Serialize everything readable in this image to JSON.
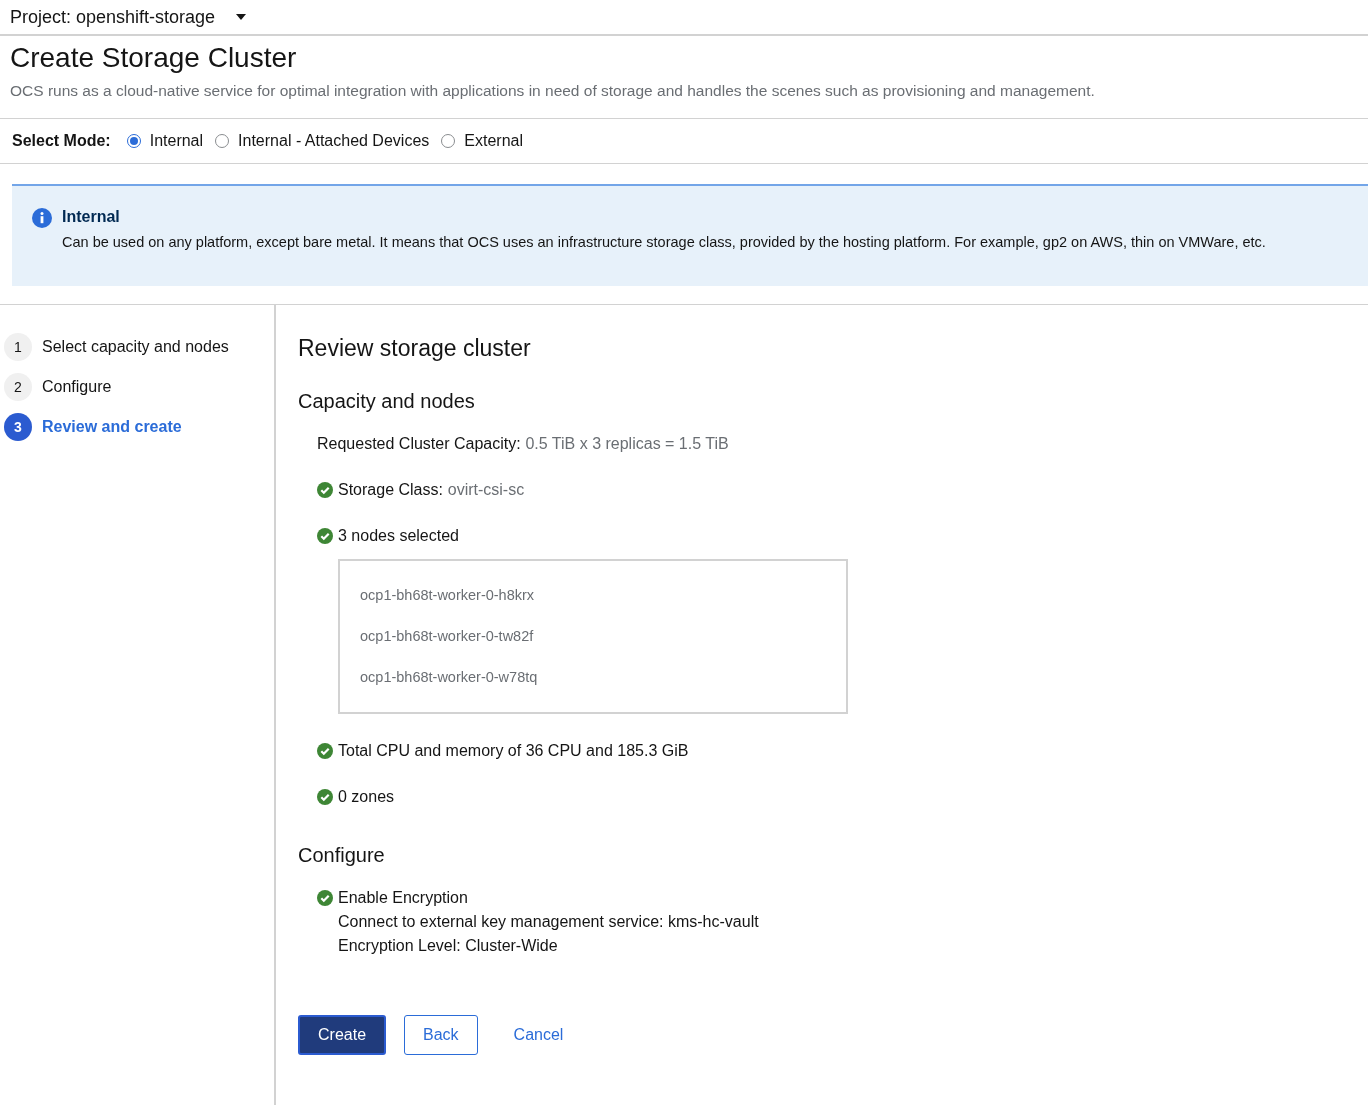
{
  "project": {
    "label": "Project: openshift-storage"
  },
  "page": {
    "title": "Create Storage Cluster",
    "description": "OCS runs as a cloud-native service for optimal integration with applications in need of storage and handles the scenes such as provisioning and management."
  },
  "mode": {
    "label": "Select Mode:",
    "options": [
      {
        "label": "Internal",
        "selected": true
      },
      {
        "label": "Internal - Attached Devices",
        "selected": false
      },
      {
        "label": "External",
        "selected": false
      }
    ]
  },
  "alert": {
    "title": "Internal",
    "text": "Can be used on any platform, except bare metal. It means that OCS uses an infrastructure storage class, provided by the hosting platform. For example, gp2 on AWS, thin on VMWare, etc."
  },
  "steps": [
    {
      "number": "1",
      "label": "Select capacity and nodes",
      "selected": false
    },
    {
      "number": "2",
      "label": "Configure",
      "selected": false
    },
    {
      "number": "3",
      "label": "Review and create",
      "selected": true
    }
  ],
  "review": {
    "title": "Review storage cluster",
    "sections": [
      {
        "title": "Capacity and nodes",
        "items": [
          {
            "checked": false,
            "label": "Requested Cluster Capacity:",
            "value": "0.5 TiB x 3 replicas = 1.5 TiB"
          },
          {
            "checked": true,
            "label": "Storage Class:",
            "value": "ovirt-csi-sc"
          },
          {
            "checked": true,
            "label": "3 nodes selected",
            "nodes": [
              "ocp1-bh68t-worker-0-h8krx",
              "ocp1-bh68t-worker-0-tw82f",
              "ocp1-bh68t-worker-0-w78tq"
            ]
          },
          {
            "checked": true,
            "label": "Total CPU and memory of 36 CPU and 185.3 GiB"
          },
          {
            "checked": true,
            "label": "0 zones"
          }
        ]
      },
      {
        "title": "Configure",
        "items": [
          {
            "checked": true,
            "label": "Enable Encryption",
            "details": [
              "Connect to external key management service: kms-hc-vault",
              "Encryption Level: Cluster-Wide"
            ]
          }
        ]
      }
    ]
  },
  "buttons": [
    {
      "kind": "primary",
      "label": "Create"
    },
    {
      "kind": "secondary",
      "label": "Back"
    },
    {
      "kind": "link",
      "label": "Cancel"
    }
  ]
}
